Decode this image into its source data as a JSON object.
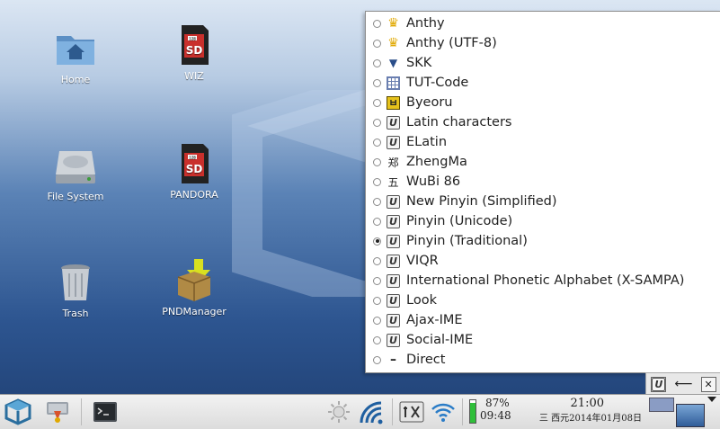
{
  "desktop": {
    "icons": [
      {
        "label": "Home"
      },
      {
        "label": "WIZ"
      },
      {
        "label": "File System"
      },
      {
        "label": "PANDORA"
      },
      {
        "label": "Trash"
      },
      {
        "label": "PNDManager"
      }
    ],
    "sd_text": "SD",
    "sd_small": "128"
  },
  "input_menu": {
    "items": [
      {
        "label": "Anthy",
        "icon": "crown-icon",
        "checked": false
      },
      {
        "label": "Anthy (UTF-8)",
        "icon": "crown-icon",
        "checked": false
      },
      {
        "label": "SKK",
        "icon": "triangle-icon",
        "checked": false
      },
      {
        "label": "TUT-Code",
        "icon": "grid-icon",
        "checked": false
      },
      {
        "label": "Byeoru",
        "icon": "byeoru-icon",
        "checked": false,
        "glyph": "ㅂ"
      },
      {
        "label": "Latin characters",
        "icon": "ime-icon",
        "checked": false
      },
      {
        "label": "ELatin",
        "icon": "ime-icon",
        "checked": false
      },
      {
        "label": "ZhengMa",
        "icon": "cjk-icon",
        "checked": false,
        "glyph": "郑"
      },
      {
        "label": "WuBi 86",
        "icon": "cjk-icon",
        "checked": false,
        "glyph": "五"
      },
      {
        "label": "New Pinyin (Simplified)",
        "icon": "ime-icon",
        "checked": false
      },
      {
        "label": "Pinyin (Unicode)",
        "icon": "ime-icon",
        "checked": false
      },
      {
        "label": "Pinyin (Traditional)",
        "icon": "ime-icon",
        "checked": true
      },
      {
        "label": "VIQR",
        "icon": "ime-icon",
        "checked": false
      },
      {
        "label": "International Phonetic Alphabet (X-SAMPA)",
        "icon": "ime-icon",
        "checked": false
      },
      {
        "label": "Look",
        "icon": "ime-icon",
        "checked": false
      },
      {
        "label": "Ajax-IME",
        "icon": "ime-icon",
        "checked": false
      },
      {
        "label": "Social-IME",
        "icon": "ime-icon",
        "checked": false
      },
      {
        "label": "Direct",
        "icon": "dash-icon",
        "checked": false
      }
    ]
  },
  "tray": {
    "ime_glyph": "U",
    "arrow": "⟵",
    "tool": "✕"
  },
  "taskbar": {
    "battery_percent": "87%",
    "battery_level": 0.87,
    "uptime": "09:48",
    "time": "21:00",
    "date": "三 西元2014年01月08日"
  },
  "colors": {
    "desktop_top": "#dbe6f3",
    "desktop_bottom": "#1f3f72",
    "battery_green": "#2fbf3a"
  }
}
